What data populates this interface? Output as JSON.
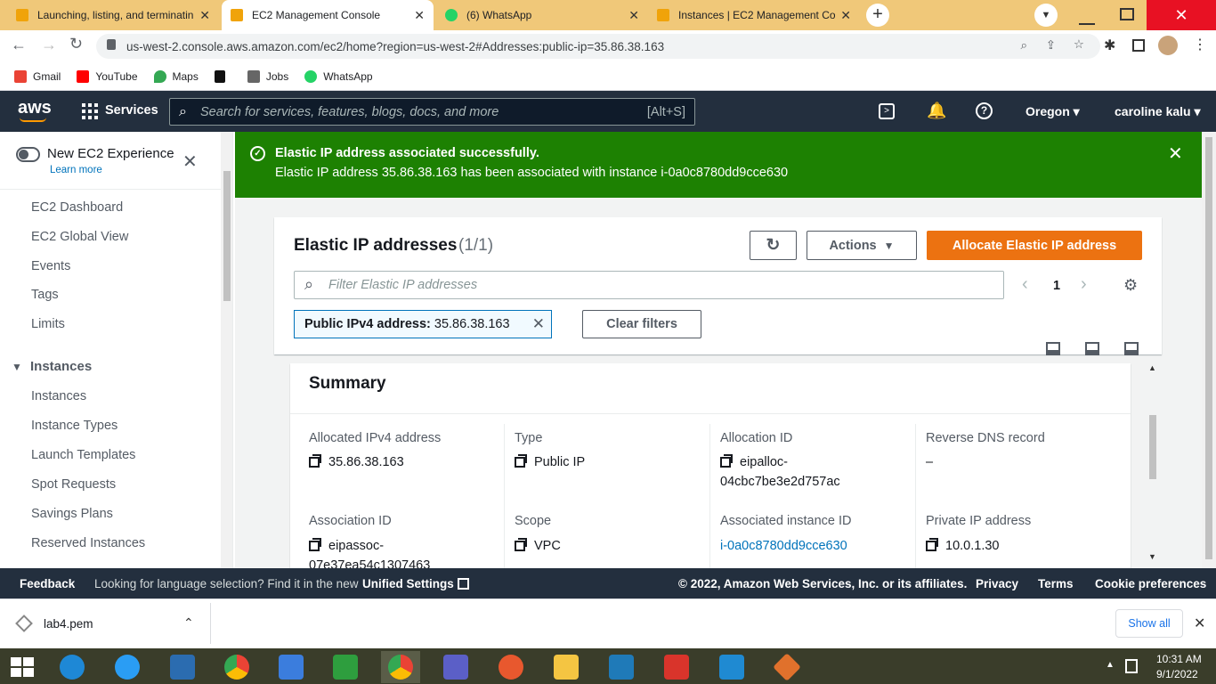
{
  "browser": {
    "tabs": [
      {
        "title": "Launching, listing, and terminatin",
        "favicon_color": "#f0a30a"
      },
      {
        "title": "EC2 Management Console",
        "favicon_color": "#f0a30a"
      },
      {
        "title": "(6) WhatsApp",
        "favicon_color": "#25d366"
      },
      {
        "title": "Instances | EC2 Management Cor",
        "favicon_color": "#f0a30a"
      }
    ],
    "url": "us-west-2.console.aws.amazon.com/ec2/home?region=us-west-2#Addresses:public-ip=35.86.38.163",
    "bookmarks": [
      {
        "label": "Gmail",
        "color": "#ea4335"
      },
      {
        "label": "YouTube",
        "color": "#ff0000"
      },
      {
        "label": "Maps",
        "color": "#34a853"
      },
      {
        "label": "",
        "color": "#111111"
      },
      {
        "label": "Jobs",
        "color": "#555555"
      },
      {
        "label": "WhatsApp",
        "color": "#25d366"
      }
    ]
  },
  "aws_nav": {
    "logo": "aws",
    "services": "Services",
    "search_placeholder": "Search for services, features, blogs, docs, and more",
    "search_shortcut": "[Alt+S]",
    "region": "Oregon",
    "user": "caroline kalu"
  },
  "sidebar": {
    "toggle_label": "New EC2 Experience",
    "learn_more": "Learn more",
    "items": [
      "EC2 Dashboard",
      "EC2 Global View",
      "Events",
      "Tags",
      "Limits"
    ],
    "section": "Instances",
    "section_items": [
      "Instances",
      "Instance Types",
      "Launch Templates",
      "Spot Requests",
      "Savings Plans",
      "Reserved Instances"
    ]
  },
  "flash": {
    "title": "Elastic IP address associated successfully.",
    "message": "Elastic IP address 35.86.38.163 has been associated with instance i-0a0c8780dd9cce630"
  },
  "table": {
    "title": "Elastic IP addresses",
    "count": "(1/1)",
    "actions": "Actions",
    "allocate": "Allocate Elastic IP address",
    "filter_placeholder": "Filter Elastic IP addresses",
    "page": "1",
    "token_key": "Public IPv4 address:",
    "token_value": "35.86.38.163",
    "clear_filters": "Clear filters"
  },
  "summary": {
    "title": "Summary",
    "fields": [
      {
        "label": "Allocated IPv4 address",
        "value": "35.86.38.163"
      },
      {
        "label": "Type",
        "value": "Public IP"
      },
      {
        "label": "Allocation ID",
        "value": "eipalloc-",
        "value2": "04cbc7be3e2d757ac"
      },
      {
        "label": "Reverse DNS record",
        "value": "–"
      },
      {
        "label": "Association ID",
        "value": "eipassoc-",
        "value2": "07e37ea54c1307463"
      },
      {
        "label": "Scope",
        "value": "VPC"
      },
      {
        "label": "Associated instance ID",
        "value": "i-0a0c8780dd9cce630"
      },
      {
        "label": "Private IP address",
        "value": "10.0.1.30"
      }
    ]
  },
  "footer": {
    "feedback": "Feedback",
    "language_text": "Looking for language selection? Find it in the new",
    "unified": "Unified Settings",
    "copyright": "© 2022, Amazon Web Services, Inc. or its affiliates.",
    "privacy": "Privacy",
    "terms": "Terms",
    "cookies": "Cookie preferences"
  },
  "downloads": {
    "file": "lab4.pem",
    "show_all": "Show all"
  },
  "taskbar": {
    "time": "10:31 AM",
    "date": "9/1/2022"
  },
  "colors": {
    "aws_nav": "#232f3e",
    "flash": "#1d8102",
    "primary": "#ec7211",
    "link": "#0073bb"
  }
}
